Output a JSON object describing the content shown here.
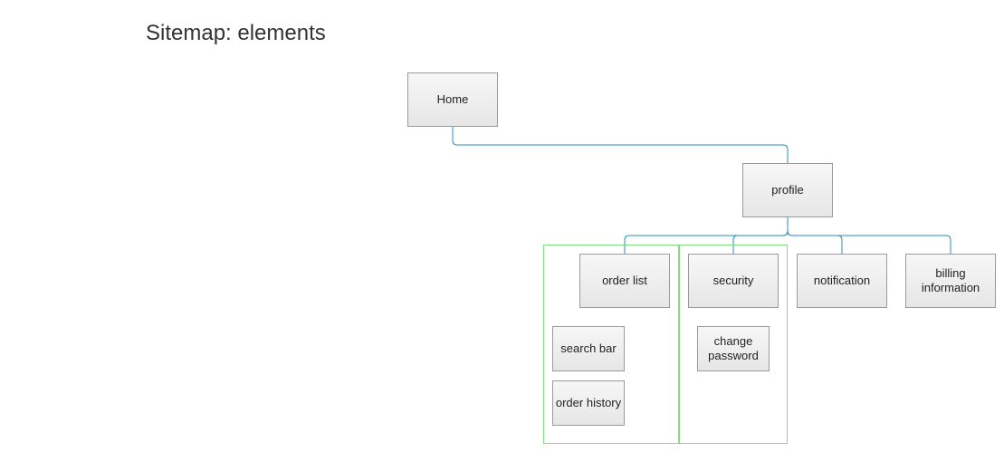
{
  "title": "Sitemap: elements",
  "colors": {
    "connector": "#2a8fbd",
    "group_border": "#7ee07e",
    "node_border": "#9a9a9a",
    "node_fill_top": "#f7f7f7",
    "node_fill_bottom": "#e6e6e6"
  },
  "nodes": {
    "home": "Home",
    "profile": "profile",
    "order_list": "order list",
    "security": "security",
    "notification": "notification",
    "billing_information": "billing information",
    "search_bar": "search bar",
    "order_history": "order history",
    "change_password": "change password"
  },
  "hierarchy": {
    "home": [
      "profile"
    ],
    "profile": [
      "order_list",
      "security",
      "notification",
      "billing_information"
    ],
    "order_list": [
      "search_bar",
      "order_history"
    ],
    "security": [
      "change_password"
    ]
  }
}
